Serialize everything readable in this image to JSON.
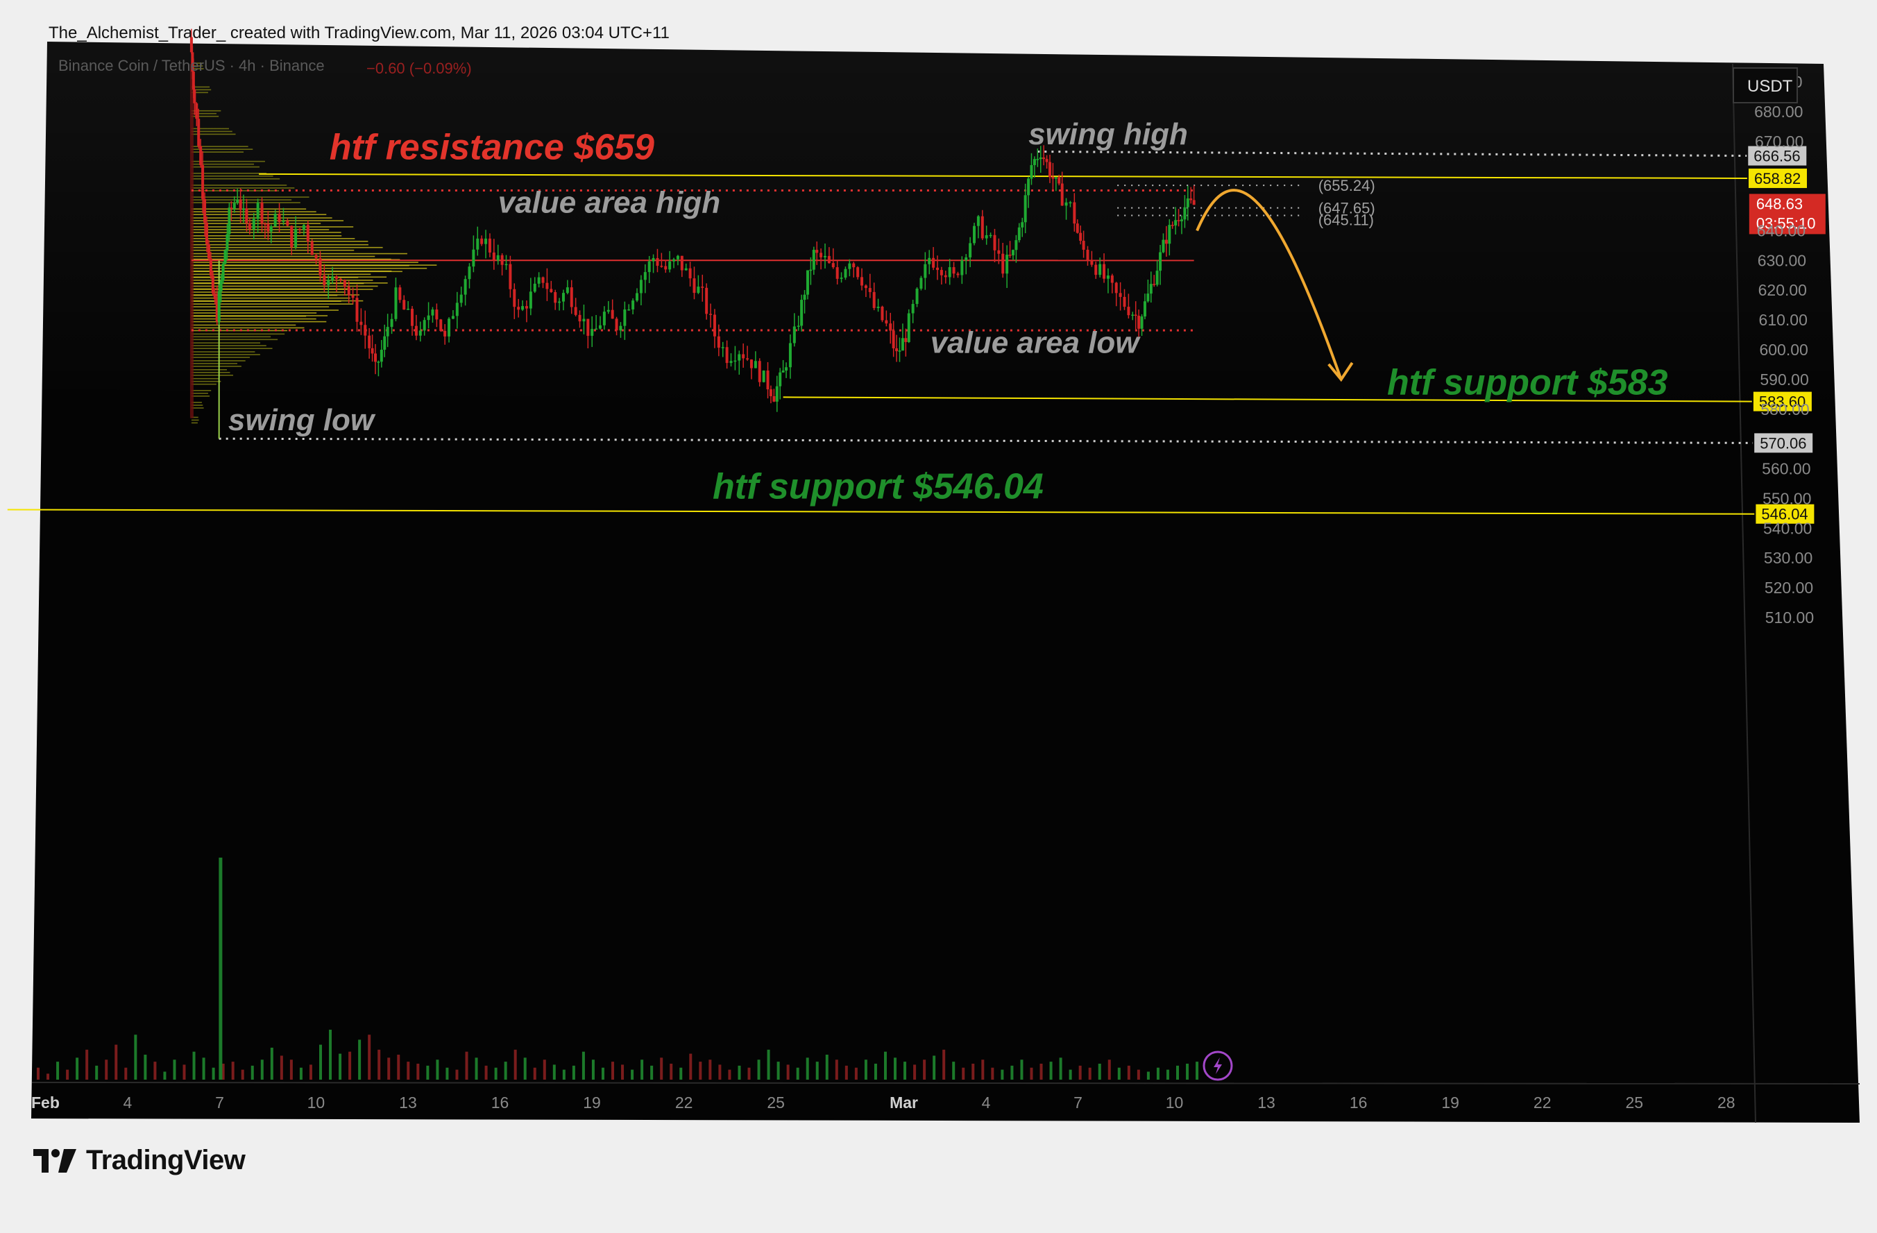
{
  "credit": "The_Alchemist_Trader_ created with TradingView.com, Mar 11, 2026 03:04 UTC+11",
  "brand": "TradingView",
  "chart_data": {
    "type": "candlestick",
    "symbol_header": "Binance Coin / TetherUS · 4h · Binance",
    "change": "−0.60 (−0.09%)",
    "currency": "USDT",
    "ylim": [
      505,
      697
    ],
    "y_ticks": [
      "690.00",
      "680.00",
      "670.00",
      "640.00",
      "630.00",
      "620.00",
      "610.00",
      "600.00",
      "590.00",
      "580.00",
      "560.00",
      "550.00",
      "540.00",
      "530.00",
      "520.00",
      "510.00"
    ],
    "y_tick_values": [
      690,
      680,
      670,
      640,
      630,
      620,
      610,
      600,
      590,
      580,
      560,
      550,
      540,
      530,
      520,
      510
    ],
    "x_ticks": [
      {
        "label": "Feb",
        "day": 1,
        "bold": true
      },
      {
        "label": "4",
        "day": 4
      },
      {
        "label": "7",
        "day": 7
      },
      {
        "label": "10",
        "day": 10
      },
      {
        "label": "13",
        "day": 13
      },
      {
        "label": "16",
        "day": 16
      },
      {
        "label": "19",
        "day": 19
      },
      {
        "label": "22",
        "day": 22
      },
      {
        "label": "25",
        "day": 25
      },
      {
        "label": "Mar",
        "day": 29,
        "bold": true
      },
      {
        "label": "4",
        "day": 32
      },
      {
        "label": "7",
        "day": 35
      },
      {
        "label": "10",
        "day": 38
      },
      {
        "label": "13",
        "day": 41
      },
      {
        "label": "16",
        "day": 44
      },
      {
        "label": "19",
        "day": 47
      },
      {
        "label": "22",
        "day": 50
      },
      {
        "label": "25",
        "day": 53
      },
      {
        "label": "28",
        "day": 56
      }
    ],
    "price_path": [
      [
        6.0,
        705
      ],
      [
        6.1,
        690
      ],
      [
        6.3,
        670
      ],
      [
        6.5,
        645
      ],
      [
        6.7,
        622
      ],
      [
        6.9,
        612
      ],
      [
        7.1,
        628
      ],
      [
        7.3,
        645
      ],
      [
        7.6,
        652
      ],
      [
        7.9,
        641
      ],
      [
        8.3,
        648
      ],
      [
        8.6,
        640
      ],
      [
        9.0,
        645
      ],
      [
        9.4,
        637
      ],
      [
        9.8,
        642
      ],
      [
        10.2,
        630
      ],
      [
        10.6,
        622
      ],
      [
        11.0,
        626
      ],
      [
        11.4,
        615
      ],
      [
        11.8,
        605
      ],
      [
        12.1,
        593
      ],
      [
        12.4,
        603
      ],
      [
        12.8,
        618
      ],
      [
        13.2,
        611
      ],
      [
        13.6,
        604
      ],
      [
        14.0,
        616
      ],
      [
        14.4,
        603
      ],
      [
        14.8,
        618
      ],
      [
        15.2,
        628
      ],
      [
        15.6,
        638
      ],
      [
        16.0,
        632
      ],
      [
        16.4,
        626
      ],
      [
        16.8,
        612
      ],
      [
        17.2,
        618
      ],
      [
        17.6,
        624
      ],
      [
        18.0,
        616
      ],
      [
        18.4,
        620
      ],
      [
        18.8,
        612
      ],
      [
        19.2,
        604
      ],
      [
        19.6,
        612
      ],
      [
        20.0,
        608
      ],
      [
        20.4,
        616
      ],
      [
        20.8,
        624
      ],
      [
        21.2,
        631
      ],
      [
        21.6,
        627
      ],
      [
        22.0,
        630
      ],
      [
        22.4,
        624
      ],
      [
        22.8,
        618
      ],
      [
        23.2,
        605
      ],
      [
        23.6,
        598
      ],
      [
        24.0,
        600
      ],
      [
        24.4,
        596
      ],
      [
        24.8,
        590
      ],
      [
        25.1,
        585
      ],
      [
        25.4,
        592
      ],
      [
        25.8,
        605
      ],
      [
        26.1,
        620
      ],
      [
        26.4,
        632
      ],
      [
        26.8,
        630
      ],
      [
        27.2,
        624
      ],
      [
        27.6,
        631
      ],
      [
        28.0,
        624
      ],
      [
        28.4,
        614
      ],
      [
        28.8,
        608
      ],
      [
        29.1,
        598
      ],
      [
        29.4,
        605
      ],
      [
        29.8,
        618
      ],
      [
        30.2,
        631
      ],
      [
        30.6,
        628
      ],
      [
        31.0,
        624
      ],
      [
        31.4,
        634
      ],
      [
        31.8,
        642
      ],
      [
        32.2,
        636
      ],
      [
        32.6,
        628
      ],
      [
        32.9,
        632
      ],
      [
        33.2,
        645
      ],
      [
        33.5,
        662
      ],
      [
        33.8,
        667
      ],
      [
        34.1,
        660
      ],
      [
        34.4,
        653
      ],
      [
        34.8,
        648
      ],
      [
        35.1,
        635
      ],
      [
        35.5,
        630
      ],
      [
        35.9,
        624
      ],
      [
        36.3,
        618
      ],
      [
        36.7,
        614
      ],
      [
        37.0,
        610
      ],
      [
        37.3,
        618
      ],
      [
        37.6,
        628
      ],
      [
        37.9,
        638
      ],
      [
        38.2,
        644
      ],
      [
        38.5,
        648
      ],
      [
        38.8,
        648.63
      ]
    ],
    "volume_profile": {
      "max_width_days": 8.0,
      "rows": [
        [
          696,
          0.05
        ],
        [
          688,
          0.08
        ],
        [
          680,
          0.12
        ],
        [
          674,
          0.18
        ],
        [
          668,
          0.25
        ],
        [
          663,
          0.3
        ],
        [
          659,
          0.36
        ],
        [
          655,
          0.42
        ],
        [
          651,
          0.48
        ],
        [
          647,
          0.55
        ],
        [
          644,
          0.62
        ],
        [
          641,
          0.66
        ],
        [
          638,
          0.72
        ],
        [
          635,
          0.78
        ],
        [
          632,
          0.88
        ],
        [
          630,
          1.0
        ],
        [
          628,
          0.96
        ],
        [
          626,
          0.86
        ],
        [
          624,
          0.8
        ],
        [
          622,
          0.76
        ],
        [
          620,
          0.74
        ],
        [
          618,
          0.7
        ],
        [
          616,
          0.66
        ],
        [
          613,
          0.6
        ],
        [
          611,
          0.55
        ],
        [
          608,
          0.46
        ],
        [
          605,
          0.38
        ],
        [
          602,
          0.33
        ],
        [
          599,
          0.28
        ],
        [
          596,
          0.22
        ],
        [
          593,
          0.17
        ],
        [
          590,
          0.12
        ],
        [
          586,
          0.08
        ],
        [
          582,
          0.05
        ],
        [
          577,
          0.03
        ]
      ]
    },
    "volume_bars": {
      "max_height_fraction_of_panel": 1.0,
      "values": [
        0.12,
        0.06,
        0.18,
        0.1,
        0.22,
        0.3,
        0.14,
        0.2,
        0.35,
        0.12,
        0.45,
        0.25,
        0.18,
        0.08,
        0.2,
        0.15,
        0.28,
        0.22,
        0.12,
        0.16,
        0.18,
        0.1,
        0.14,
        0.2,
        0.32,
        0.24,
        0.2,
        0.12,
        0.15,
        0.35,
        0.5,
        0.26,
        0.28,
        0.4,
        0.45,
        0.3,
        0.22,
        0.25,
        0.18,
        0.16,
        0.14,
        0.2,
        0.12,
        0.1,
        0.28,
        0.22,
        0.14,
        0.12,
        0.18,
        0.3,
        0.22,
        0.12,
        0.2,
        0.15,
        0.1,
        0.14,
        0.28,
        0.2,
        0.12,
        0.18,
        0.15,
        0.1,
        0.2,
        0.14,
        0.22,
        0.16,
        0.12,
        0.26,
        0.18,
        0.2,
        0.15,
        0.1,
        0.14,
        0.12,
        0.2,
        0.3,
        0.18,
        0.15,
        0.12,
        0.22,
        0.18,
        0.25,
        0.2,
        0.14,
        0.12,
        0.2,
        0.16,
        0.28,
        0.22,
        0.18,
        0.15,
        0.2,
        0.24,
        0.3,
        0.18,
        0.12,
        0.16,
        0.2,
        0.12,
        0.1,
        0.14,
        0.2,
        0.12,
        0.16,
        0.18,
        0.22,
        0.1,
        0.14,
        0.12,
        0.16,
        0.2,
        0.12,
        0.14,
        0.1,
        0.08,
        0.12,
        0.1,
        0.14,
        0.16,
        0.18
      ]
    },
    "levels": [
      {
        "name": "htf-resistance",
        "value": 659,
        "color": "#f5e400",
        "style": "solid",
        "x_start_day": 8.2,
        "tag": "658.82",
        "tag_bg": "#f5e400",
        "tag_fg": "#111"
      },
      {
        "name": "htf-support-583",
        "value": 584,
        "color": "#f5e400",
        "style": "solid",
        "x_start_day": 25.3,
        "tag": "583.60",
        "tag_bg": "#f5e400",
        "tag_fg": "#111"
      },
      {
        "name": "htf-support-546",
        "value": 546.2,
        "color": "#f5e400",
        "style": "solid",
        "x_start_day": 0.0,
        "tag": "546.04",
        "tag_bg": "#f5e400",
        "tag_fg": "#111"
      },
      {
        "name": "swing-high",
        "value": 666.56,
        "color": "#cfcfcf",
        "style": "dotted",
        "x_start_day": 33.6,
        "tag": "666.56",
        "tag_bg": "#c9c9c9",
        "tag_fg": "#111"
      },
      {
        "name": "swing-low",
        "value": 570.06,
        "color": "#cfcfcf",
        "style": "dotted",
        "x_start_day": 6.9,
        "tag": "570.06",
        "tag_bg": "#c9c9c9",
        "tag_fg": "#111"
      },
      {
        "name": "value-area-high",
        "value": 653.5,
        "color": "#e03030",
        "style": "dotted",
        "x_start_day": 6.0,
        "x_end_day": 38.7
      },
      {
        "name": "value-area-low",
        "value": 606.5,
        "color": "#e03030",
        "style": "dotted",
        "x_start_day": 6.0,
        "x_end_day": 38.7
      },
      {
        "name": "poc",
        "value": 630,
        "color": "#e03030",
        "style": "solid",
        "x_start_day": 6.0,
        "x_end_day": 38.7
      }
    ],
    "fib_lines": [
      {
        "value": 655.24,
        "label": "(655.24)",
        "x_start_day": 36.2,
        "x_end_day": 42.3
      },
      {
        "value": 647.65,
        "label": "(647.65)",
        "x_start_day": 36.2,
        "x_end_day": 42.3
      },
      {
        "value": 645.11,
        "label": "(645.11)",
        "x_start_day": 36.2,
        "x_end_day": 42.3
      }
    ],
    "current_price": {
      "value": 648.63,
      "label": "648.63",
      "countdown": "03:55:10",
      "bg": "#d42a24"
    },
    "projection": {
      "color": "#f0a830",
      "points": [
        [
          38.8,
          640
        ],
        [
          40.0,
          655
        ],
        [
          41.4,
          642
        ],
        [
          43.5,
          590
        ]
      ]
    },
    "annotations": [
      {
        "text": "htf resistance $659",
        "color": "#e3342b",
        "day": 10.5,
        "value": 664,
        "size": 52
      },
      {
        "text": "swing high",
        "color": "#9c9c9c",
        "day": 33.3,
        "value": 669,
        "size": 44
      },
      {
        "text": "value area high",
        "color": "#9c9c9c",
        "day": 16.0,
        "value": 646,
        "size": 44
      },
      {
        "text": "value area low",
        "color": "#9c9c9c",
        "day": 30.1,
        "value": 599,
        "size": 44
      },
      {
        "text": "htf support $583",
        "color": "#1f8f2b",
        "day": 45.0,
        "value": 585,
        "size": 52
      },
      {
        "text": "swing low",
        "color": "#9c9c9c",
        "day": 7.2,
        "value": 573,
        "size": 44
      },
      {
        "text": "htf support $546.04",
        "color": "#1f8f2b",
        "day": 23.0,
        "value": 550,
        "size": 52
      }
    ]
  }
}
